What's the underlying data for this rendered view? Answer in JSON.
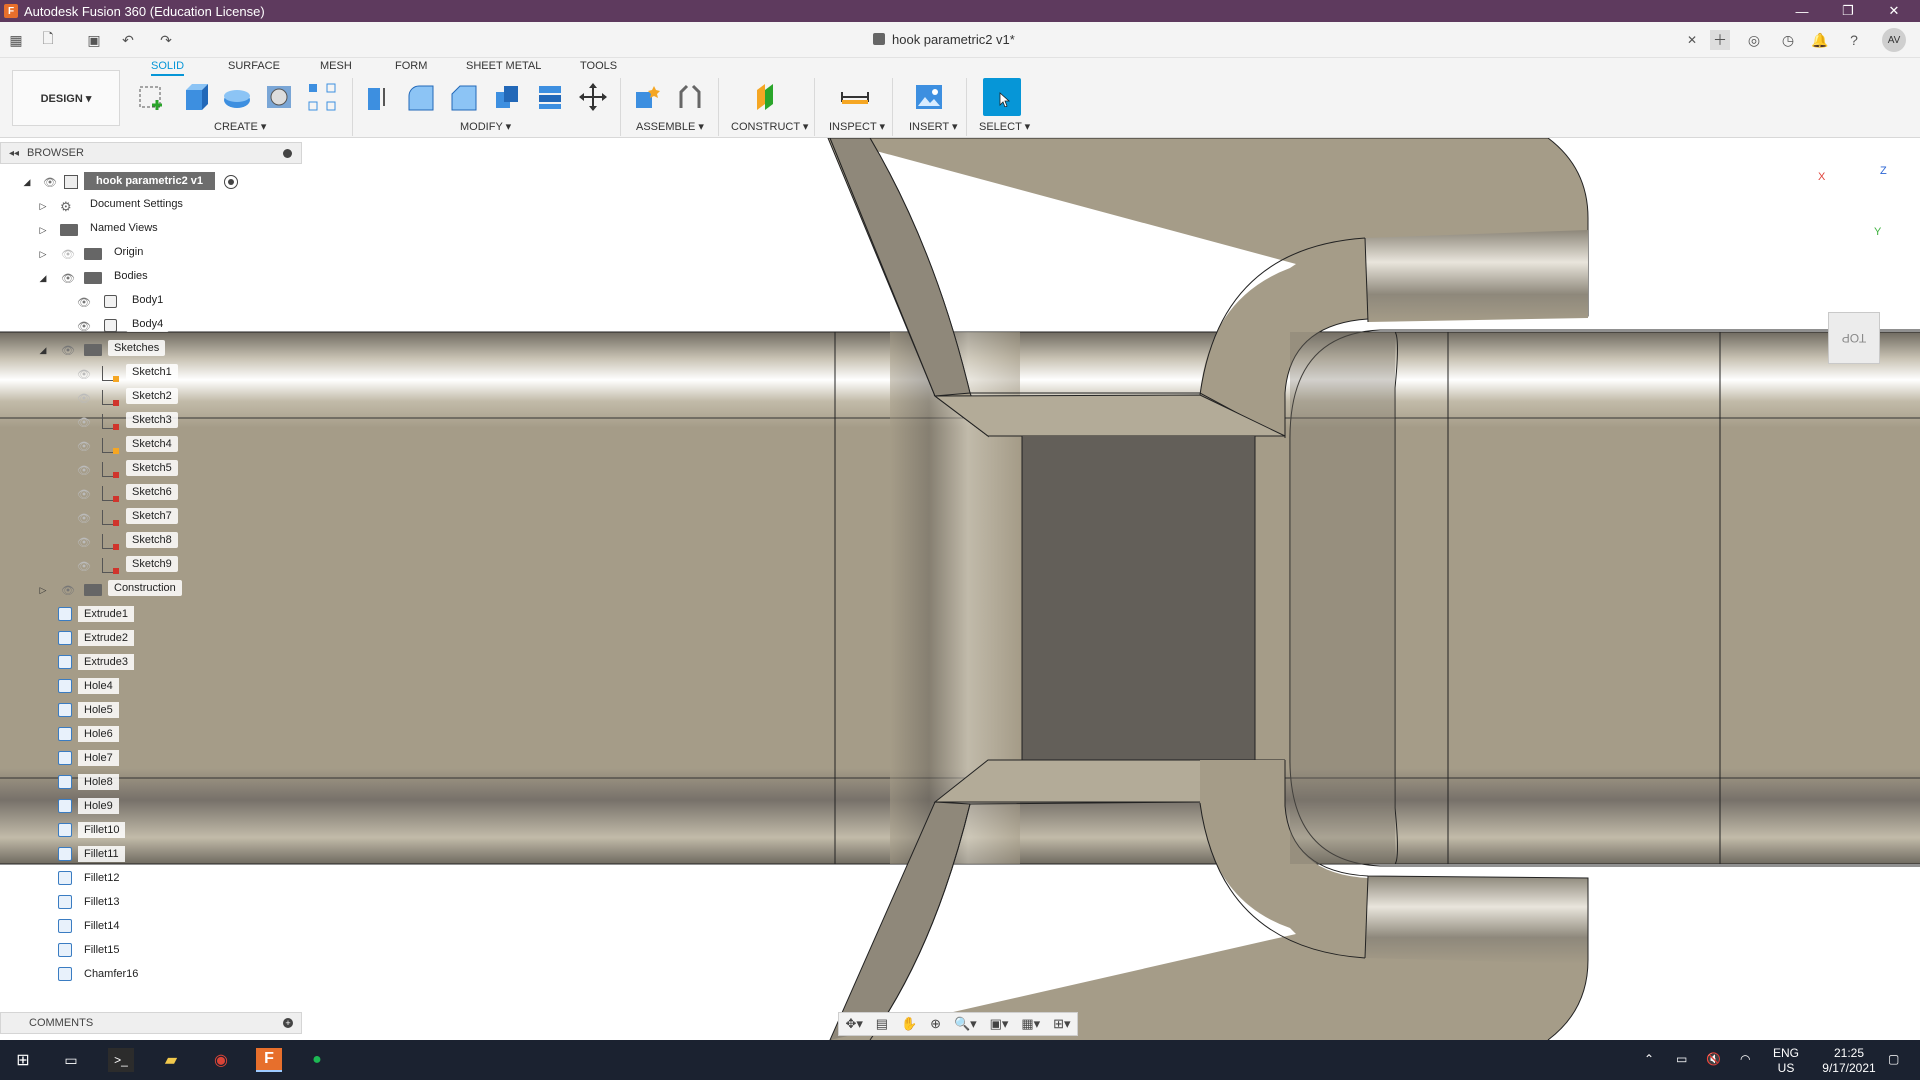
{
  "window": {
    "title": "Autodesk Fusion 360 (Education License)",
    "app_icon_letter": "F",
    "minimize": "—",
    "restore": "❐",
    "close": "✕"
  },
  "quick_access": {
    "doc_title": "hook parametric2 v1*",
    "close_tab": "✕",
    "user_initials": "AV"
  },
  "ribbon": {
    "tabs": [
      "SOLID",
      "SURFACE",
      "MESH",
      "FORM",
      "SHEET METAL",
      "TOOLS"
    ],
    "workspace": "DESIGN ▾",
    "groups": [
      "CREATE ▾",
      "MODIFY ▾",
      "ASSEMBLE ▾",
      "CONSTRUCT ▾",
      "INSPECT ▾",
      "INSERT ▾",
      "SELECT ▾"
    ]
  },
  "browser": {
    "title": "BROWSER",
    "root": "hook parametric2 v1",
    "folders": [
      "Document Settings",
      "Named Views",
      "Origin",
      "Bodies"
    ],
    "bodies": [
      "Body1",
      "Body4"
    ],
    "sketches_folder": "Sketches",
    "sketches": [
      "Sketch1",
      "Sketch2",
      "Sketch3",
      "Sketch4",
      "Sketch5",
      "Sketch6",
      "Sketch7",
      "Sketch8",
      "Sketch9"
    ],
    "construction": "Construction",
    "features": [
      "Extrude1",
      "Extrude2",
      "Extrude3",
      "Hole4",
      "Hole5",
      "Hole6",
      "Hole7",
      "Hole8",
      "Hole9",
      "Fillet10",
      "Fillet11",
      "Fillet12",
      "Fillet13",
      "Fillet14",
      "Fillet15",
      "Chamfer16"
    ]
  },
  "comments": {
    "title": "COMMENTS"
  },
  "viewcube": {
    "face": "TOP",
    "axis_x": "X",
    "axis_y": "Y",
    "axis_z": "Z"
  },
  "taskbar": {
    "lang": "ENG",
    "region": "US",
    "time": "21:25",
    "date": "9/17/2021"
  },
  "colors": {
    "titlebar": "#5e3a5e",
    "accent": "#0696d7",
    "model": "#a59c88",
    "taskbar": "#1b2230"
  }
}
